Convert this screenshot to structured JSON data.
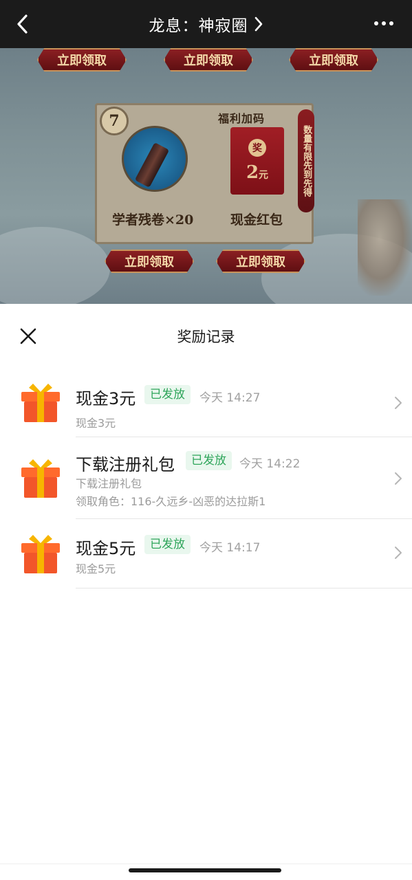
{
  "nav": {
    "title": "龙息：神寂圈",
    "icons": {
      "back": "chevron-left-icon",
      "title_arrow": "chevron-right-icon",
      "more": "more-dots-icon"
    }
  },
  "background": {
    "claim_buttons": [
      "立即领取",
      "立即领取",
      "立即领取",
      "立即领取",
      "立即领取"
    ],
    "reward_card": {
      "day_number": "7",
      "left_item_label": "学者残卷×20",
      "bonus_title": "福利加码",
      "red_packet_badge": "奖",
      "red_packet_amount": "2",
      "red_packet_unit": "元",
      "right_item_label": "现金红包",
      "side_tag": "数量有限先到先得"
    }
  },
  "sheet": {
    "title": "奖励记录",
    "records": [
      {
        "name": "现金3元",
        "status": "已发放",
        "time": "今天 14:27",
        "details": [
          "现金3元"
        ]
      },
      {
        "name": "下载注册礼包",
        "status": "已发放",
        "time": "今天 14:22",
        "details": [
          "下载注册礼包",
          "领取角色：116-久远乡-凶恶的达拉斯1"
        ]
      },
      {
        "name": "现金5元",
        "status": "已发放",
        "time": "今天 14:17",
        "details": [
          "现金5元"
        ]
      }
    ],
    "colors": {
      "status_text": "#2ea55a",
      "status_bg": "#e9f7ee",
      "gift_body": "#f2562a",
      "gift_ribbon": "#f7b500"
    }
  }
}
